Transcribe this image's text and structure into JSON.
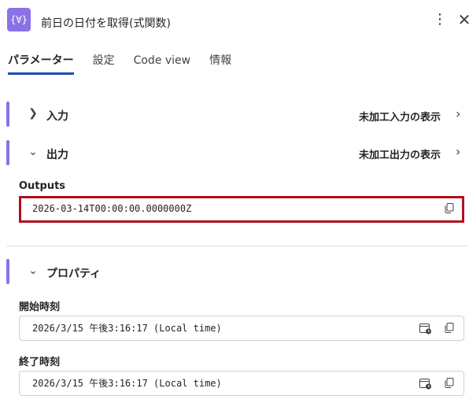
{
  "header": {
    "icon_text": "{∀}",
    "title": "前日の日付を取得(式関数)",
    "more_icon": "more-vertical-icon",
    "close_icon": "close-icon"
  },
  "tabs": [
    {
      "label": "パラメーター",
      "active": true
    },
    {
      "label": "設定",
      "active": false
    },
    {
      "label": "Code view",
      "active": false
    },
    {
      "label": "情報",
      "active": false
    }
  ],
  "sections": {
    "input": {
      "label": "入力",
      "link": "未加工入力の表示",
      "expanded": false
    },
    "output": {
      "label": "出力",
      "link": "未加工出力の表示",
      "expanded": true
    },
    "properties": {
      "label": "プロパティ",
      "expanded": true
    }
  },
  "outputs": {
    "label": "Outputs",
    "value": "2026-03-14T00:00:00.0000000Z"
  },
  "properties": {
    "start": {
      "label": "開始時刻",
      "value": "2026/3/15 午後3:16:17 (Local time)"
    },
    "end": {
      "label": "終了時刻",
      "value": "2026/3/15 午後3:16:17 (Local time)"
    }
  },
  "colors": {
    "accent": "#8a72e6",
    "tab_underline": "#1f4bb4",
    "highlight_border": "#b0101f"
  }
}
